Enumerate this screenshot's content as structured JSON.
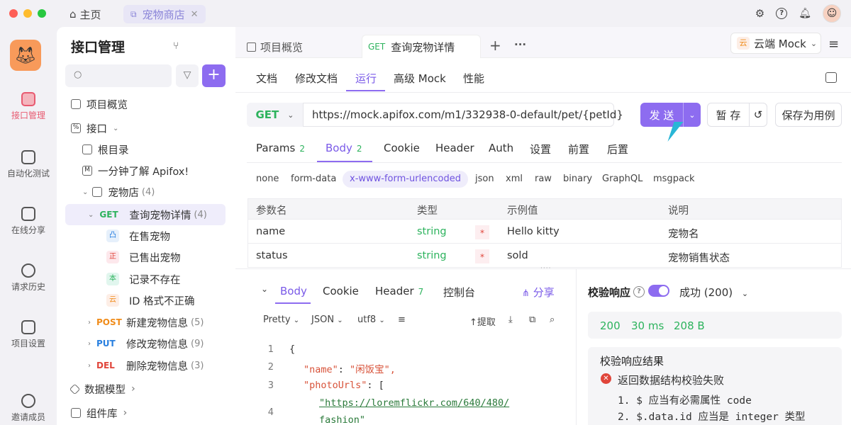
{
  "titlebar": {
    "home_label": "主页",
    "tab_label": "宠物商店"
  },
  "leftnav": {
    "items": [
      {
        "label": "接口管理",
        "icon": "api-icon"
      },
      {
        "label": "自动化测试",
        "icon": "automation-icon"
      },
      {
        "label": "在线分享",
        "icon": "share-doc-icon"
      },
      {
        "label": "请求历史",
        "icon": "history-icon"
      },
      {
        "label": "项目设置",
        "icon": "settings-icon"
      },
      {
        "label": "邀请成员",
        "icon": "invite-icon"
      }
    ]
  },
  "sidebar": {
    "title": "接口管理",
    "tree": {
      "overview": "项目概览",
      "api": "接口",
      "root": "根目录",
      "intro": "一分钟了解 Apifox!",
      "petshop": "宠物店",
      "petshop_count": "(4)",
      "get_method": "GET",
      "get_label": "查询宠物详情",
      "get_count": "(4)",
      "case1": "在售宠物",
      "case2": "已售出宠物",
      "case2_tag": "正",
      "case3": "记录不存在",
      "case3_tag": "本",
      "case4": "ID 格式不正确",
      "case4_tag": "云",
      "post_method": "POST",
      "post_label": "新建宠物信息",
      "post_count": "(5)",
      "put_method": "PUT",
      "put_label": "修改宠物信息",
      "put_count": "(9)",
      "del_method": "DEL",
      "del_label": "删除宠物信息",
      "del_count": "(3)",
      "models": "数据模型",
      "components": "组件库"
    }
  },
  "tabs": {
    "overview": "项目概览",
    "active_method": "GET",
    "active_label": "查询宠物详情",
    "add": "+",
    "more": "···",
    "env_tag": "云",
    "env_label": "云端 Mock"
  },
  "subnav": {
    "items": [
      "文档",
      "修改文档",
      "运行",
      "高级 Mock",
      "性能"
    ],
    "active": "运行"
  },
  "request": {
    "method": "GET",
    "url": "https://mock.apifox.com/m1/332938-0-default/pet/{petId}",
    "send": "发 送",
    "save": "暂 存",
    "save_case": "保存为用例"
  },
  "req_tabs": {
    "params": "Params",
    "params_count": "2",
    "body": "Body",
    "body_count": "2",
    "cookie": "Cookie",
    "header": "Header",
    "auth": "Auth",
    "settings": "设置",
    "pre": "前置",
    "post": "后置"
  },
  "body_types": [
    "none",
    "form-data",
    "x-www-form-urlencoded",
    "json",
    "xml",
    "raw",
    "binary",
    "GraphQL",
    "msgpack"
  ],
  "params_table": {
    "headers": [
      "参数名",
      "类型",
      "示例值",
      "说明"
    ],
    "rows": [
      {
        "name": "name",
        "type": "string",
        "required": "*",
        "example": "Hello kitty",
        "desc": "宠物名"
      },
      {
        "name": "status",
        "type": "string",
        "required": "*",
        "example": "sold",
        "desc": "宠物销售状态"
      }
    ]
  },
  "response": {
    "tabs": {
      "body": "Body",
      "cookie": "Cookie",
      "header": "Header",
      "header_count": "7",
      "console": "控制台",
      "share": "分享"
    },
    "toolbar": {
      "pretty": "Pretty",
      "format": "JSON",
      "encoding": "utf8",
      "extract": "提取"
    },
    "lines": [
      {
        "n": "1",
        "text": "{"
      },
      {
        "n": "2",
        "key": "\"name\"",
        "val": "\"闲饭宝\","
      },
      {
        "n": "3",
        "key": "\"photoUrls\"",
        "val": "["
      },
      {
        "n": "4",
        "link": "\"https://loremflickr.com/640/480/",
        "cont": "fashion\""
      }
    ]
  },
  "validation": {
    "label": "校验响应",
    "result": "成功 (200)",
    "status": "200",
    "time": "30 ms",
    "size": "208 B",
    "title": "校验响应结果",
    "error": "返回数据结构校验失败",
    "details": [
      "1. $ 应当有必需属性 code",
      "2. $.data.id 应当是 integer 类型"
    ]
  },
  "colors": {
    "accent": "#8d6cf0",
    "get": "#2db35d",
    "post": "#f08c1a",
    "put": "#2980e0",
    "delete": "#e0453a"
  }
}
